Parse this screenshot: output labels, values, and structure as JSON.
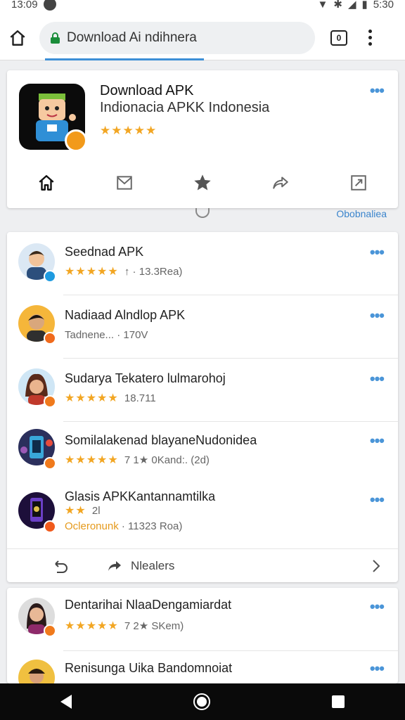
{
  "status_bar": {
    "time_left": "13:09",
    "time_right": "5:30"
  },
  "browser": {
    "url_text": "Download Ai ndihnera",
    "tab_count": "0"
  },
  "app": {
    "title": "Download APK",
    "subtitle": "Indionacia APKK Indonesia",
    "stars": "★★★★★",
    "actions": [
      "home-icon",
      "inbox-icon",
      "star-icon",
      "share-icon",
      "open-external-icon"
    ]
  },
  "link": {
    "label": "Obobnaliea"
  },
  "list": {
    "items": [
      {
        "title": "Seednad APK",
        "stars": "★★★★★",
        "meta": "↑ · 13.3Rea)",
        "badge_color": "#1f9be0"
      },
      {
        "title": "Nadiaad Alndlop APK",
        "stars": "",
        "meta": "Tadnene... · 170V",
        "badge_color": "#f06a1c"
      },
      {
        "title": "Sudarya Tekatero lulmarohoj",
        "stars": "★★★★★",
        "meta": "18.711",
        "badge_color": "#f07a1c"
      },
      {
        "title": "Somilalakenad blayaneNudonidea",
        "stars": "★★★★★",
        "meta": "7 1★ 0Kand:. (2d)",
        "badge_color": "#f07a1c"
      },
      {
        "title": "Glasis APKKantannamtilka",
        "stars": "★★",
        "extra": "2l",
        "meta_highlight": "Ocleronunk",
        "meta": " · 11323 Roa)",
        "badge_color": "#f05a1c"
      }
    ],
    "footer_label": "Nlealers"
  },
  "list2": {
    "items": [
      {
        "title": "Dentarihai NlaaDengamiardat",
        "stars": "★★★★★",
        "meta": "7 2★ SKem)",
        "badge_color": "#f07a1c"
      },
      {
        "title": "Renisunga Uika Bandomnoiat",
        "stars": "",
        "meta": "",
        "badge_color": "#f07a1c"
      }
    ]
  },
  "colors": {
    "accent": "#4a95d8",
    "star": "#f2a623",
    "secure": "#1a8d3a",
    "nav": "#0a0a0a"
  }
}
